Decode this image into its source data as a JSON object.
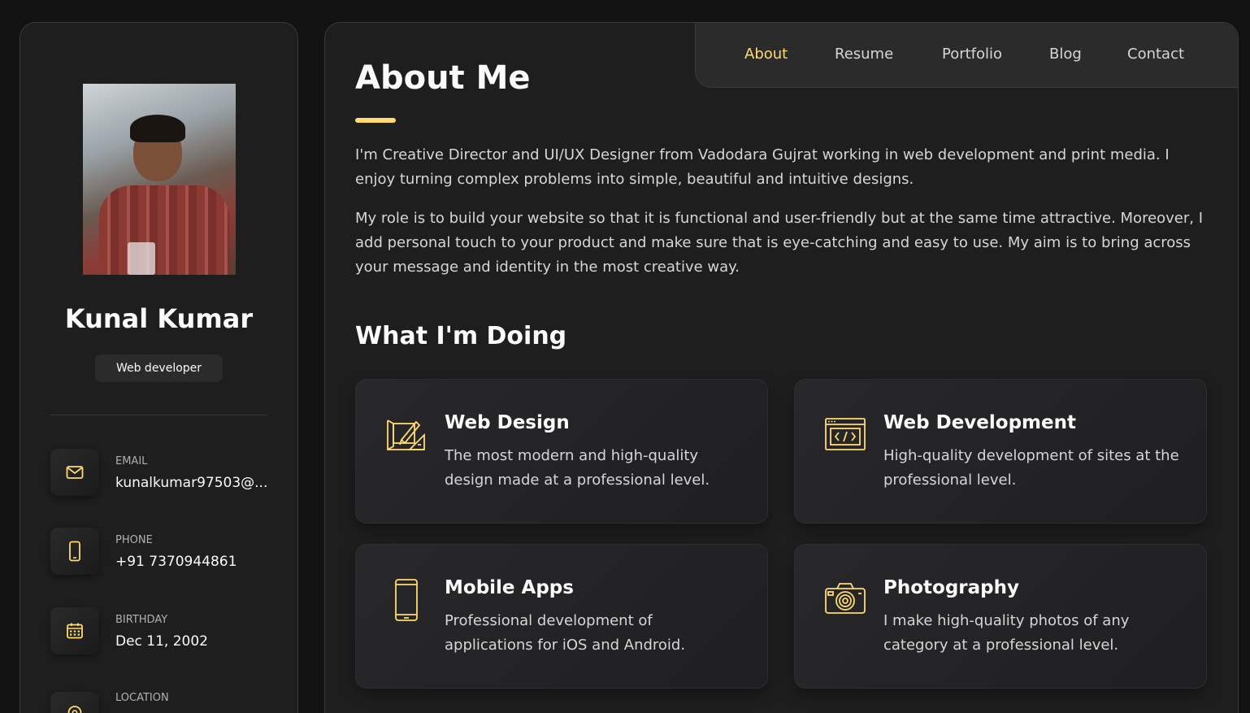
{
  "sidebar": {
    "name": "Kunal Kumar",
    "title": "Web developer",
    "contacts": [
      {
        "label": "EMAIL",
        "value": "kunalkumar97503@...",
        "icon": "mail-icon"
      },
      {
        "label": "PHONE",
        "value": "+91 7370944861",
        "icon": "phone-icon"
      },
      {
        "label": "BIRTHDAY",
        "value": "Dec 11, 2002",
        "icon": "calendar-icon"
      },
      {
        "label": "LOCATION",
        "value": "",
        "icon": "location-icon"
      }
    ]
  },
  "nav": {
    "items": [
      {
        "label": "About",
        "active": true
      },
      {
        "label": "Resume",
        "active": false
      },
      {
        "label": "Portfolio",
        "active": false
      },
      {
        "label": "Blog",
        "active": false
      },
      {
        "label": "Contact",
        "active": false
      }
    ]
  },
  "about": {
    "title": "About Me",
    "paragraphs": [
      "I'm Creative Director and UI/UX Designer from Vadodara Gujrat working in web development and print media. I enjoy turning complex problems into simple, beautiful and intuitive designs.",
      "My role is to build your website so that it is functional and user-friendly but at the same time attractive. Moreover, I add personal touch to your product and make sure that is eye-catching and easy to use. My aim is to bring across your message and identity in the most creative way."
    ]
  },
  "services": {
    "title": "What I'm Doing",
    "items": [
      {
        "title": "Web Design",
        "text": "The most modern and high-quality design made at a professional level.",
        "icon": "design-icon"
      },
      {
        "title": "Web Development",
        "text": "High-quality development of sites at the professional level.",
        "icon": "code-icon"
      },
      {
        "title": "Mobile Apps",
        "text": "Professional development of applications for iOS and Android.",
        "icon": "mobile-icon"
      },
      {
        "title": "Photography",
        "text": "I make high-quality photos of any category at a professional level.",
        "icon": "camera-icon"
      }
    ]
  },
  "colors": {
    "accent": "#ffdb70",
    "background": "#121212",
    "panel": "#1e1e1f"
  }
}
